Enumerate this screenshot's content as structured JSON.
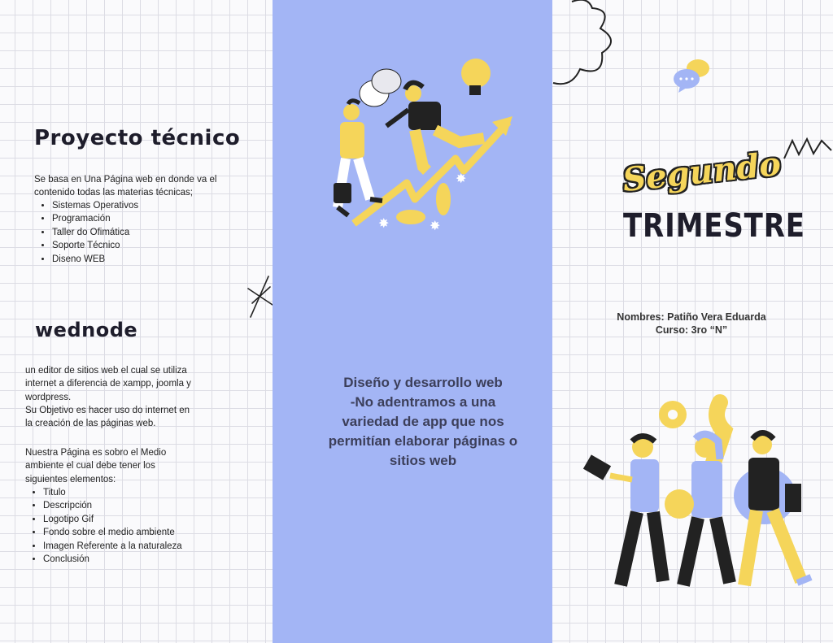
{
  "left_panel": {
    "section1": {
      "title": "Proyecto técnico",
      "intro": "Se basa en Una Página web en donde va el contenido todas las materias técnicas;",
      "items": [
        "Sistemas Operativos",
        "Programación",
        "Taller do Ofimática",
        "Soporte Técnico",
        "Diseno WEB"
      ]
    },
    "section2": {
      "title": "wednode",
      "para1": " un editor de sitios web el cual se utiliza internet a diferencia de xampp, joomla y wordpress.",
      "para2": "Su Objetivo es hacer uso do internet en la creación de las páginas web.",
      "para3": "Nuestra Página es sobro el Medio ambiente el cual debe tener los siguientes elementos:",
      "items": [
        "Titulo",
        "Descripción",
        "Logotipo Gif",
        "Fondo sobre el medio ambiente",
        "Imagen Referente a la naturaleza",
        "Conclusión"
      ]
    }
  },
  "middle_panel": {
    "lines": [
      "Diseño y desarrollo web",
      "-No adentramos a una",
      "variedad de app que nos",
      "permitían elaborar páginas o",
      "sitios web"
    ],
    "background_color": "#a3b5f5"
  },
  "right_panel": {
    "title_script": "Segundo",
    "title_main": "TRIMESTRE",
    "names_line": "Nombres: Patiño Vera Eduarda",
    "course_line": "Curso: 3ro “N”"
  },
  "colors": {
    "accent_yellow": "#f5d55a",
    "accent_blue": "#a3b5f5",
    "ink": "#1e1d2b"
  }
}
